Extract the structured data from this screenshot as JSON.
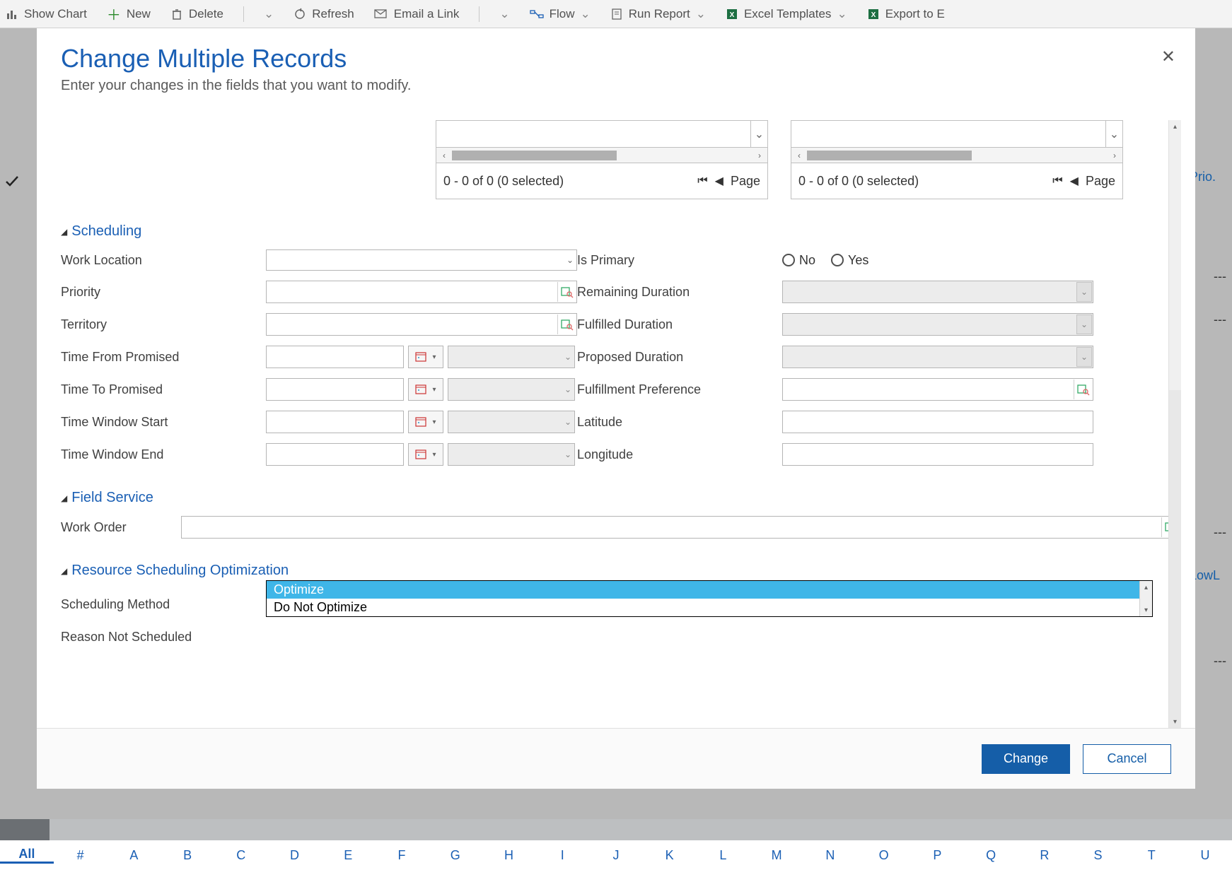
{
  "toolbar": {
    "show_chart": "Show Chart",
    "new": "New",
    "delete": "Delete",
    "refresh": "Refresh",
    "email_link": "Email a Link",
    "flow": "Flow",
    "run_report": "Run Report",
    "excel_templates": "Excel Templates",
    "export": "Export to E"
  },
  "modal": {
    "title": "Change Multiple Records",
    "subtitle": "Enter your changes in the fields that you want to modify.",
    "close": "✕",
    "change_btn": "Change",
    "cancel_btn": "Cancel"
  },
  "panes": {
    "status_left": "0 - 0 of 0 (0 selected)",
    "status_right": "0 - 0 of 0 (0 selected)",
    "page_label": "Page"
  },
  "sections": {
    "scheduling": "Scheduling",
    "field_service": "Field Service",
    "rso": "Resource Scheduling Optimization"
  },
  "labels": {
    "work_location": "Work Location",
    "priority": "Priority",
    "territory": "Territory",
    "time_from_promised": "Time From Promised",
    "time_to_promised": "Time To Promised",
    "time_window_start": "Time Window Start",
    "time_window_end": "Time Window End",
    "is_primary": "Is Primary",
    "remaining_duration": "Remaining Duration",
    "fulfilled_duration": "Fulfilled Duration",
    "proposed_duration": "Proposed Duration",
    "fulfillment_preference": "Fulfillment Preference",
    "latitude": "Latitude",
    "longitude": "Longitude",
    "work_order": "Work Order",
    "scheduling_method": "Scheduling Method",
    "reason_not_scheduled": "Reason Not Scheduled"
  },
  "radios": {
    "no": "No",
    "yes": "Yes"
  },
  "dropdown": {
    "optimize": "Optimize",
    "do_not_optimize": "Do Not Optimize"
  },
  "alpha": {
    "all": "All",
    "letters": [
      "#",
      "A",
      "B",
      "C",
      "D",
      "E",
      "F",
      "G",
      "H",
      "I",
      "J",
      "K",
      "L",
      "M",
      "N",
      "O",
      "P",
      "Q",
      "R",
      "S",
      "T",
      "U"
    ]
  },
  "bg_hints": {
    "prio": "Prio.",
    "lowl": "LowL"
  }
}
